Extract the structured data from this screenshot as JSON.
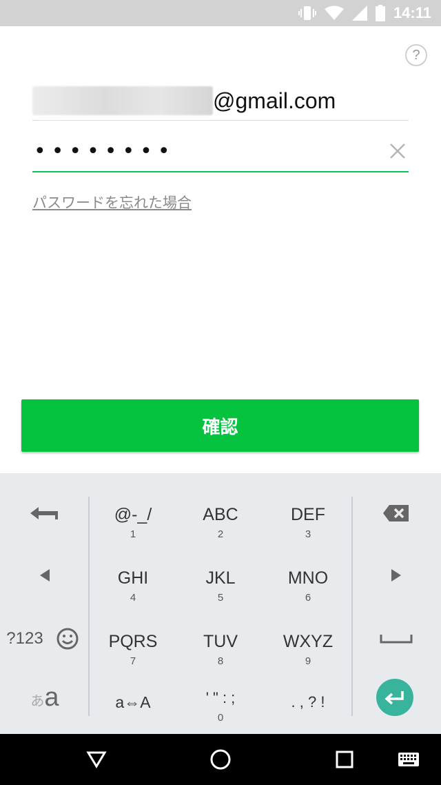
{
  "status_bar": {
    "time": "14:11",
    "icons": [
      "vibrate-icon",
      "wifi-icon",
      "signal-icon",
      "battery-icon"
    ]
  },
  "help": {
    "label": "?"
  },
  "login": {
    "email_domain": "@gmail.com",
    "password_mask": "••••••••",
    "forgot_password": "パスワードを忘れた場合",
    "confirm_label": "確認",
    "accent_color": "#06c755"
  },
  "keyboard": {
    "rows": [
      [
        {
          "main": "@-_/",
          "sub": "1"
        },
        {
          "main": "ABC",
          "sub": "2"
        },
        {
          "main": "DEF",
          "sub": "3"
        }
      ],
      [
        {
          "main": "GHI",
          "sub": "4"
        },
        {
          "main": "JKL",
          "sub": "5"
        },
        {
          "main": "MNO",
          "sub": "6"
        }
      ],
      [
        {
          "main": "PQRS",
          "sub": "7"
        },
        {
          "main": "TUV",
          "sub": "8"
        },
        {
          "main": "WXYZ",
          "sub": "9"
        }
      ],
      [
        {
          "main": "a⇔A",
          "sub": ""
        },
        {
          "main": "' \" : ;",
          "sub": "0"
        },
        {
          "main": ". , ? !",
          "sub": ""
        }
      ]
    ],
    "symbols_label": "?123",
    "kana_label": "あ",
    "alpha_label": "a"
  },
  "nav": {
    "buttons": [
      "back-icon",
      "home-icon",
      "recents-icon",
      "keyboard-icon"
    ]
  }
}
